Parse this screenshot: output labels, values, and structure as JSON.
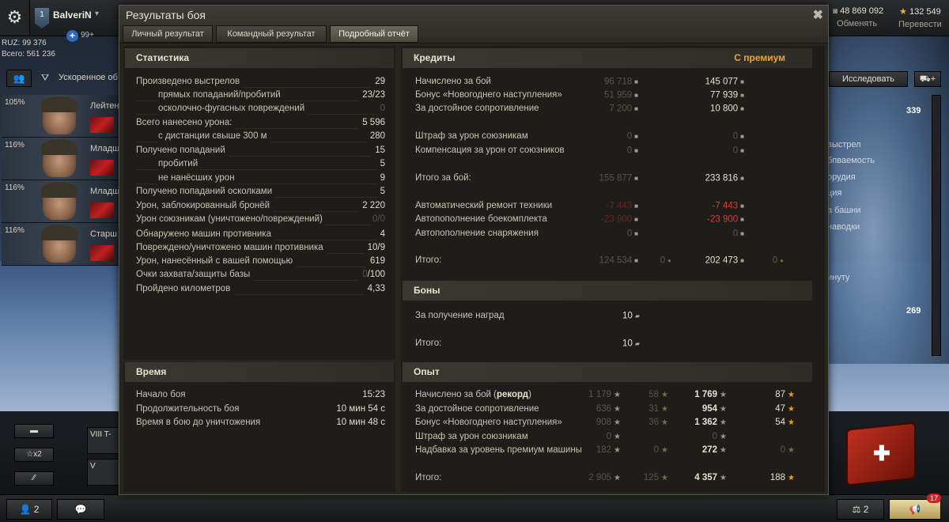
{
  "garage": {
    "player_name": "BalveriN",
    "player_rank": "1",
    "premium_count": "99+",
    "ruz_label": "RUZ: 99 376",
    "total_label": "Всего: 561 236",
    "credits_value": "48 869 092",
    "credits_action": "Обменять",
    "gold_value": "132 549",
    "gold_action": "Перевести",
    "accelerated_label": "Ускоренное об",
    "research_button": "Исследовать",
    "crew": [
      {
        "pct": "105%",
        "role": "Лейтен"
      },
      {
        "pct": "116%",
        "role": "Младш"
      },
      {
        "pct": "116%",
        "role": "Младш"
      },
      {
        "pct": "116%",
        "role": "Старш"
      }
    ],
    "right_values": {
      "top": "339",
      "bottom": "269"
    },
    "right_texts": [
      "выстрел",
      "бпваемость",
      "орудия",
      "ция",
      "а башни",
      "наводки",
      "инуту"
    ],
    "bottom_left": {
      "multiplier": "☆x2",
      "tank_tier_1": "VIII",
      "tank_name_1": "T-",
      "tank_tier_2": "V"
    },
    "bottom_bar": {
      "friends": "2",
      "squad_count": "2",
      "notifications": "17"
    }
  },
  "dialog": {
    "title": "Результаты боя",
    "tabs": [
      "Личный результат",
      "Командный результат",
      "Подробный отчёт"
    ],
    "active_tab": "Подробный отчёт"
  },
  "statistics": {
    "header": "Статистика",
    "rows": [
      {
        "label": "Произведено выстрелов",
        "value": "29",
        "indent": false,
        "dim": false
      },
      {
        "label": "прямых попаданий/пробитий",
        "value": "23/23",
        "indent": true,
        "dim": false
      },
      {
        "label": "осколочно-фугасных повреждений",
        "value": "0",
        "indent": true,
        "dim": true
      },
      {
        "label": "Всего нанесено урона:",
        "value": "5 596",
        "indent": false,
        "dim": false
      },
      {
        "label": "с дистанции свыше 300 м",
        "value": "280",
        "indent": true,
        "dim": false
      },
      {
        "label": "Получено попаданий",
        "value": "15",
        "indent": false,
        "dim": false
      },
      {
        "label": "пробитий",
        "value": "5",
        "indent": true,
        "dim": false
      },
      {
        "label": "не нанёсших урон",
        "value": "9",
        "indent": true,
        "dim": false
      },
      {
        "label": "Получено попаданий осколками",
        "value": "5",
        "indent": false,
        "dim": false
      },
      {
        "label": "Урон, заблокированный бронёй",
        "value": "2 220",
        "indent": false,
        "dim": false
      },
      {
        "label": "Урон союзникам (уничтожено/повреждений)",
        "value": "0/0",
        "indent": false,
        "dim": true
      },
      {
        "label": "Обнаружено машин противника",
        "value": "4",
        "indent": false,
        "dim": false
      },
      {
        "label": "Повреждено/уничтожено машин противника",
        "value": "10/9",
        "indent": false,
        "dim": false
      },
      {
        "label": "Урон, нанесённый с вашей помощью",
        "value": "619",
        "indent": false,
        "dim": false
      },
      {
        "label": "Очки захвата/защиты базы",
        "value_dim": "0",
        "value": "/100",
        "indent": false,
        "dim": false
      },
      {
        "label": "Пройдено километров",
        "value": "4,33",
        "indent": false,
        "dim": false
      }
    ]
  },
  "time": {
    "header": "Время",
    "rows": [
      {
        "label": "Начало боя",
        "value": "15:23"
      },
      {
        "label": "Продолжительность боя",
        "value": "10 мин 54 с"
      },
      {
        "label": "Время в бою до уничтожения",
        "value": "10 мин 48 с"
      }
    ]
  },
  "credits": {
    "header": "Кредиты",
    "premium_header": "С премиум",
    "rows": [
      {
        "label": "Начислено за бой",
        "base": "96 718",
        "prem": "145 077",
        "base_style": "dim",
        "prem_style": "normal"
      },
      {
        "label": "Бонус «Новогоднего наступления»",
        "base": "51 959",
        "prem": "77 939",
        "base_style": "dim",
        "prem_style": "normal"
      },
      {
        "label": "За достойное сопротивление",
        "base": "7 200",
        "prem": "10 800",
        "base_style": "dim",
        "prem_style": "normal"
      },
      {
        "label": "Штраф за урон союзникам",
        "base": "0",
        "prem": "0",
        "base_style": "dim",
        "prem_style": "dim"
      },
      {
        "label": "Компенсация за урон от союзников",
        "base": "0",
        "prem": "0",
        "base_style": "dim",
        "prem_style": "dim"
      },
      {
        "label": "Итого за бой:",
        "base": "155 877",
        "prem": "233 816",
        "base_style": "dim",
        "prem_style": "normal"
      },
      {
        "label": "Автоматический ремонт техники",
        "base": "-7 443",
        "prem": "-7 443",
        "base_style": "negdim",
        "prem_style": "neg"
      },
      {
        "label": "Автопополнение боекомплекта",
        "base": "-23 900",
        "prem": "-23 900",
        "base_style": "negdim",
        "prem_style": "neg"
      },
      {
        "label": "Автопополнение снаряжения",
        "base": "0",
        "prem": "0",
        "base_style": "dim",
        "prem_style": "dim"
      }
    ],
    "total": {
      "label": "Итого:",
      "base": "124 534",
      "base_gold": "0",
      "prem": "202 473",
      "prem_gold": "0"
    }
  },
  "bonds": {
    "header": "Боны",
    "rows": [
      {
        "label": "За получение наград",
        "value": "10"
      },
      {
        "label": "Итого:",
        "value": "10"
      }
    ]
  },
  "experience": {
    "header": "Опыт",
    "rows": [
      {
        "label": "Начислено за бой (рекорд)",
        "label_main": "Начислено за бой (",
        "label_bold": "рекорд",
        "label_end": ")",
        "base_xp": "1 179",
        "base_fxp": "58",
        "prem_xp": "1 769",
        "prem_fxp": "87"
      },
      {
        "label": "За достойное сопротивление",
        "base_xp": "636",
        "base_fxp": "31",
        "prem_xp": "954",
        "prem_fxp": "47"
      },
      {
        "label": "Бонус «Новогоднего наступления»",
        "base_xp": "908",
        "base_fxp": "36",
        "prem_xp": "1 362",
        "prem_fxp": "54"
      },
      {
        "label": "Штраф за урон союзникам",
        "base_xp": "0",
        "base_fxp": "",
        "prem_xp": "0",
        "prem_fxp": "",
        "zero": true
      },
      {
        "label": "Надбавка за уровень премиум машины",
        "base_xp": "182",
        "base_fxp": "0",
        "prem_xp": "272",
        "prem_fxp": "0",
        "fxp_dim": true
      }
    ],
    "total": {
      "label": "Итого:",
      "base_xp": "2 905",
      "base_fxp": "125",
      "prem_xp": "4 357",
      "prem_fxp": "188"
    }
  }
}
